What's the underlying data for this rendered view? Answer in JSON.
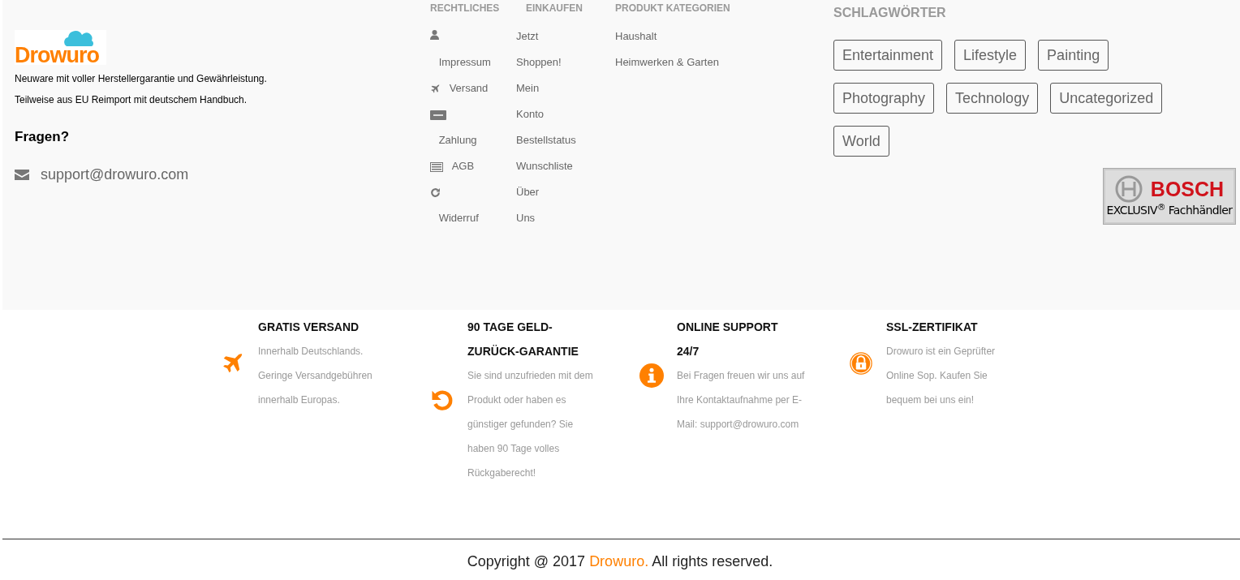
{
  "brand": {
    "logo_text": "Drowuro",
    "lines": [
      "Neuware mit voller Herstellergarantie und Gewährleistung.",
      "Teilweise aus EU Reimport mit deutschem Handbuch."
    ],
    "questions_heading": "Fragen?",
    "email": "support@drowuro.com"
  },
  "legal": {
    "heading": "RECHTLICHES",
    "items": [
      {
        "kind": "user",
        "label": "Impressum"
      },
      {
        "kind": "plane",
        "label": "Versand"
      },
      {
        "kind": "card",
        "label": "Zahlung"
      },
      {
        "kind": "list",
        "label": "AGB"
      },
      {
        "kind": "refresh",
        "label": "Widerruf"
      }
    ]
  },
  "shop": {
    "heading": "EINKAUFEN",
    "items": [
      "Jetzt Shoppen!",
      "Mein Konto",
      "Bestellstatus",
      "Wunschliste",
      "Über Uns"
    ]
  },
  "categories": {
    "heading": "PRODUKT KATEGORIEN",
    "items": [
      "Haushalt",
      "Heimwerken & Garten"
    ]
  },
  "tags": {
    "heading": "SCHLAGWÖRTER",
    "items": [
      "Entertainment",
      "Lifestyle",
      "Painting",
      "Photography",
      "Technology",
      "Uncategorized",
      "World"
    ]
  },
  "badge": {
    "brand": "BOSCH",
    "caption": "EXCLUSIV$^{®}$ Fachhändler"
  },
  "features": [
    {
      "kind": "plane",
      "title": "GRATIS VERSAND",
      "text": "Innerhalb Deutschlands. Geringe Versandgebühren innerhalb Europas."
    },
    {
      "kind": "undo",
      "title": "90 TAGE GELD-ZURÜCK-GARANTIE",
      "text": "Sie sind unzufrieden mit dem Produkt oder haben es günstiger gefunden? Sie haben 90 Tage volles Rückgaberecht!"
    },
    {
      "kind": "info",
      "title": "ONLINE SUPPORT 24/7",
      "text": "Bei Fragen freuen wir uns auf Ihre Kontaktaufnahme per E-Mail: support@drowuro.com"
    },
    {
      "kind": "lock",
      "title": "SSL-ZERTIFIKAT",
      "text": "Drowuro ist ein Geprüfter Online Sop. Kaufen Sie bequem bei uns ein!"
    }
  ],
  "copyright": {
    "before": "Copyright @ 2017",
    "brand": "Drowuro.",
    "after": "All rights reserved."
  }
}
